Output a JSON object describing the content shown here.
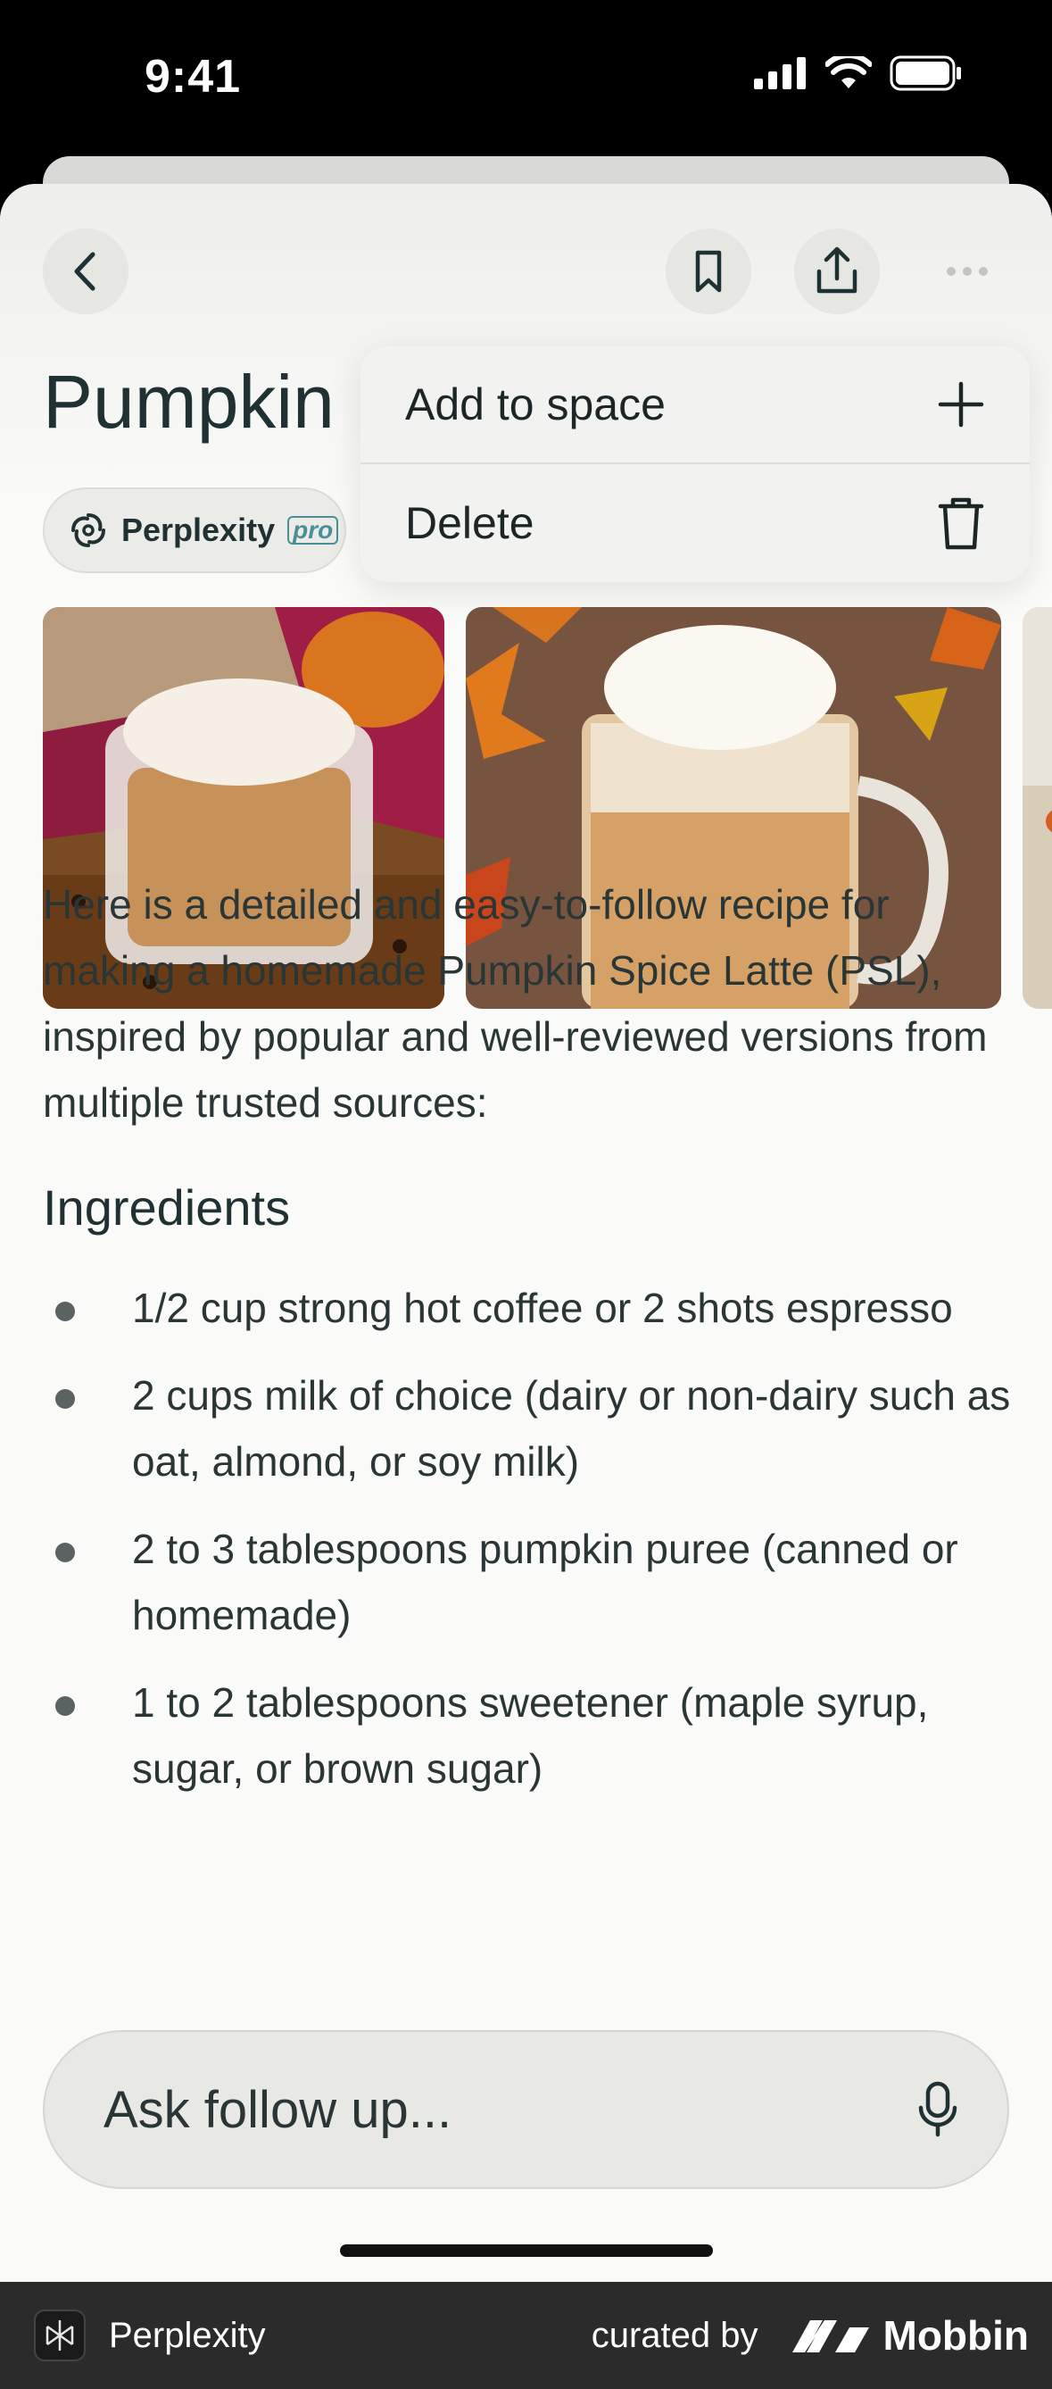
{
  "status_bar": {
    "time": "9:41"
  },
  "page": {
    "title": "Pumpkin"
  },
  "source_chip": {
    "label": "Perplexity",
    "badge": "pro"
  },
  "menu": {
    "items": [
      {
        "label": "Add to space",
        "icon": "plus-icon"
      },
      {
        "label": "Delete",
        "icon": "trash-icon"
      }
    ]
  },
  "images": [
    {
      "icon": "pumpkin-latte-photo-1"
    },
    {
      "icon": "pumpkin-latte-photo-2"
    },
    {
      "icon": "pumpkin-latte-photo-3"
    }
  ],
  "content": {
    "intro": "Here is a detailed and easy-to-follow recipe for making a homemade Pumpkin Spice Latte (PSL), inspired by popular and well-reviewed versions from multiple trusted sources:",
    "ingredients_heading": "Ingredients",
    "ingredients": [
      "1/2 cup strong hot coffee or 2 shots espresso",
      "2 cups milk of choice (dairy or non-dairy such as oat, almond, or soy milk)",
      "2 to 3 tablespoons pumpkin puree (canned or homemade)",
      "1 to 2 tablespoons sweetener (maple syrup, sugar, or brown sugar)"
    ]
  },
  "ask_bar": {
    "placeholder": "Ask follow up..."
  },
  "footer": {
    "app_name": "Perplexity",
    "curated_by": "curated by",
    "brand": "Mobbin"
  },
  "colors": {
    "accent": "#4a8f97",
    "sheet_bg": "#fafaf8",
    "text": "#1f3133"
  }
}
